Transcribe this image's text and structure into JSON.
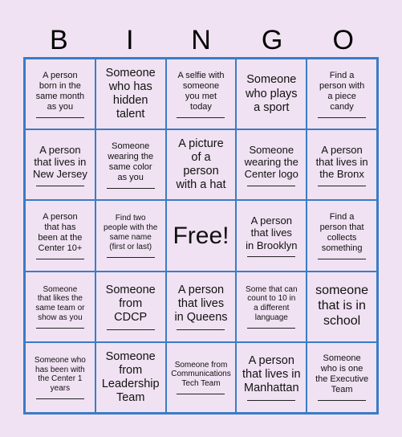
{
  "header": {
    "letters": [
      "B",
      "I",
      "N",
      "G",
      "O"
    ]
  },
  "colors": {
    "background": "#f0e2f2",
    "grid_border": "#3a7cc6",
    "text": "#111111"
  },
  "cells": [
    {
      "text": "A person\nborn in the\nsame month\nas you",
      "blank": true,
      "size": "s"
    },
    {
      "text": "Someone\nwho has\nhidden\ntalent",
      "blank": false,
      "size": "l"
    },
    {
      "text": "A selfie with\nsomeone\nyou met\ntoday",
      "blank": true,
      "size": "s"
    },
    {
      "text": "Someone\nwho plays\na sport",
      "blank": false,
      "size": "l"
    },
    {
      "text": "Find a\nperson with\na piece\ncandy",
      "blank": true,
      "size": "s"
    },
    {
      "text": "A person\nthat lives in\nNew Jersey",
      "blank": true,
      "size": "m"
    },
    {
      "text": "Someone\nwearing the\nsame color\nas you",
      "blank": true,
      "size": "s"
    },
    {
      "text": "A picture\nof a\nperson\nwith a hat",
      "blank": false,
      "size": "l"
    },
    {
      "text": "Someone\nwearing the\nCenter logo",
      "blank": true,
      "size": "m"
    },
    {
      "text": "A person\nthat lives in\nthe Bronx",
      "blank": true,
      "size": "m"
    },
    {
      "text": "A person\nthat has\nbeen at the\nCenter 10+",
      "blank": true,
      "size": "s"
    },
    {
      "text": "Find two\npeople with the\nsame name\n(first or last)",
      "blank": true,
      "size": "xs"
    },
    {
      "text": "Free!",
      "blank": false,
      "size": "free"
    },
    {
      "text": "A person\nthat lives\nin Brooklyn",
      "blank": true,
      "size": "m"
    },
    {
      "text": "Find a\nperson that\ncollects\nsomething",
      "blank": true,
      "size": "s"
    },
    {
      "text": "Someone\nthat likes the\nsame team or\nshow as you",
      "blank": true,
      "size": "xs"
    },
    {
      "text": "Someone\nfrom\nCDCP",
      "blank": true,
      "size": "l"
    },
    {
      "text": "A person\nthat lives\nin Queens",
      "blank": true,
      "size": "l"
    },
    {
      "text": "Some that can\ncount to 10 in\na different\nlanguage",
      "blank": true,
      "size": "xs"
    },
    {
      "text": "someone\nthat is in\nschool",
      "blank": false,
      "size": "xl"
    },
    {
      "text": "Someone who\nhas been with\nthe Center 1\nyears",
      "blank": true,
      "size": "xs"
    },
    {
      "text": "Someone\nfrom\nLeadership\nTeam",
      "blank": false,
      "size": "l"
    },
    {
      "text": "Someone from\nCommunications\nTech Team",
      "blank": true,
      "size": "xs"
    },
    {
      "text": "A person\nthat lives in\nManhattan",
      "blank": true,
      "size": "l"
    },
    {
      "text": "Someone\nwho is one\nthe Executive\nTeam",
      "blank": true,
      "size": "s"
    }
  ]
}
